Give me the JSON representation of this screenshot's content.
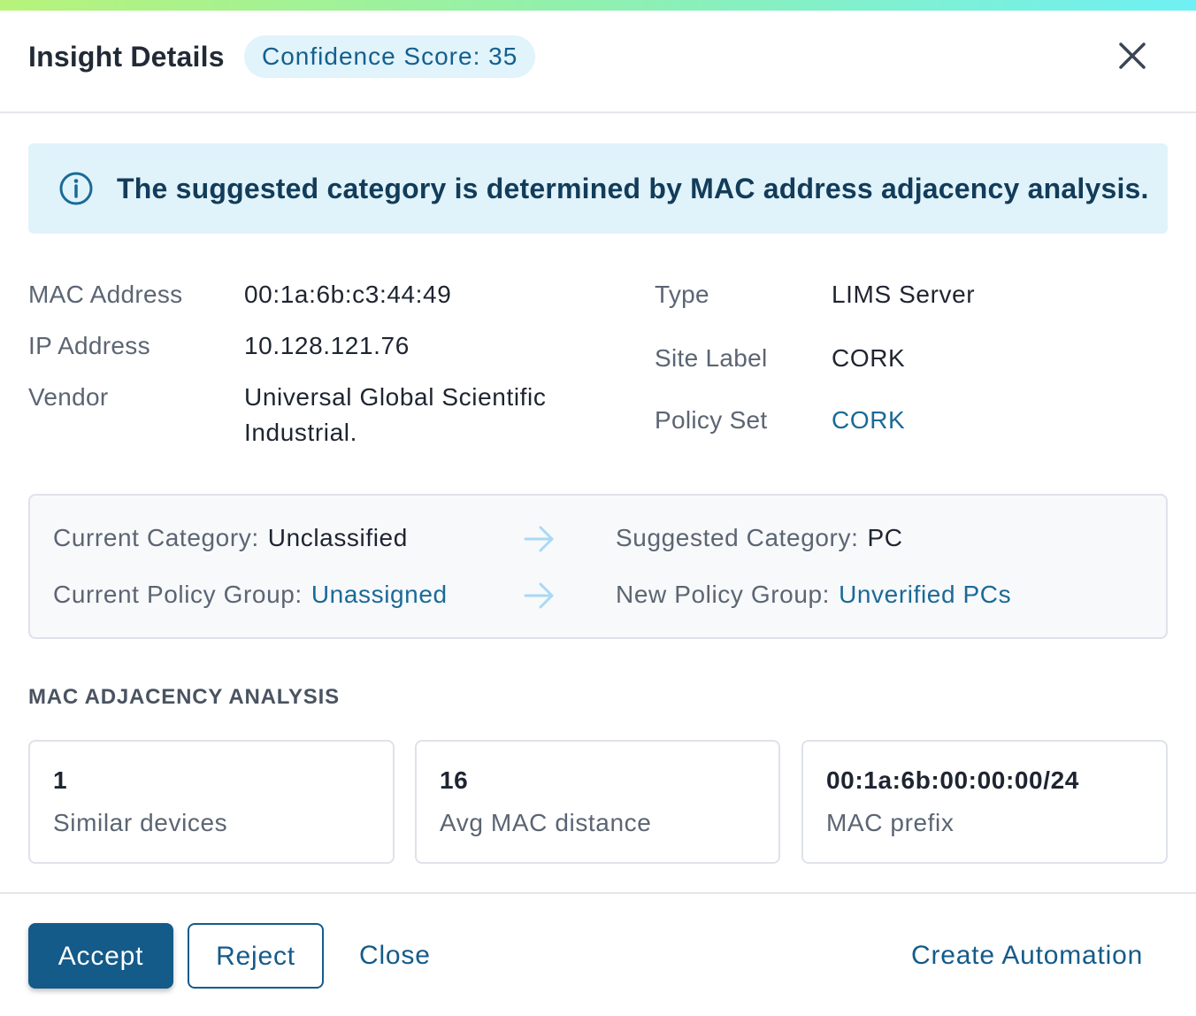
{
  "header": {
    "title": "Insight Details",
    "confidence_badge": "Confidence Score: 35"
  },
  "info_banner": {
    "icon": "info-icon",
    "text": "The suggested category is determined by MAC address adjacency analysis."
  },
  "details": {
    "left": [
      {
        "label": "MAC Address",
        "value": "00:1a:6b:c3:44:49"
      },
      {
        "label": "IP Address",
        "value": "10.128.121.76"
      },
      {
        "label": "Vendor",
        "value_line1": "Universal Global Scientific",
        "value_line2": "Industrial."
      }
    ],
    "right": [
      {
        "label": "Type",
        "value": "LIMS Server"
      },
      {
        "label": "Site Label",
        "value": "CORK"
      },
      {
        "label": "Policy Set",
        "value": "CORK"
      }
    ]
  },
  "category_change": {
    "current_category_label": "Current Category:",
    "current_category_value": "Unclassified",
    "suggested_category_label": "Suggested Category:",
    "suggested_category_value": "PC",
    "current_policy_label": "Current Policy Group:",
    "current_policy_value": "Unassigned",
    "new_policy_label": "New Policy Group:",
    "new_policy_value": "Unverified PCs"
  },
  "adjacency": {
    "section_title": "MAC ADJACENCY ANALYSIS",
    "cards": [
      {
        "value": "1",
        "label": "Similar devices"
      },
      {
        "value": "16",
        "label": "Avg MAC distance"
      },
      {
        "value": "00:1a:6b:00:00:00/24",
        "label": "MAC prefix"
      }
    ]
  },
  "footer": {
    "accept": "Accept",
    "reject": "Reject",
    "close": "Close",
    "create_automation": "Create Automation"
  },
  "colors": {
    "accent": "#145b8a",
    "link": "#1a6a96",
    "banner_bg": "#e0f3fb",
    "arrow": "#a9d9f3"
  }
}
